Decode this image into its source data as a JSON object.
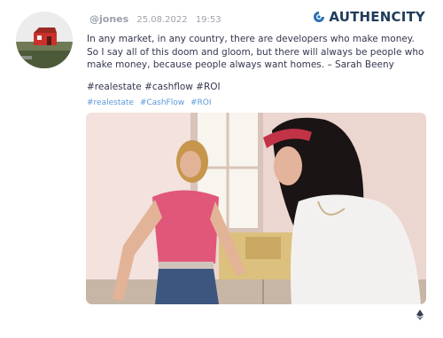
{
  "post": {
    "handle": "@jones",
    "date": "25.08.2022",
    "time": "19:53",
    "quote": "In any market, in any country, there are developers who make money. So I say all of this doom and gloom, but there will always be people who make money, because people always want homes. – Sarah Beeny",
    "hashtags_text": "#realestate #cashflow #ROI",
    "hashtag_links": [
      "#realestate",
      "#CashFlow",
      "#ROI"
    ]
  },
  "brand": {
    "name": "AUTHENCITY",
    "color": "#1f3c5a"
  },
  "icons": {
    "avatar": "red-house-avatar",
    "logo": "authencity-logo-icon",
    "chain": "ethereum-icon"
  },
  "colors": {
    "link": "#5a98d8",
    "meta": "#a0a3ad",
    "text": "#33364f"
  }
}
